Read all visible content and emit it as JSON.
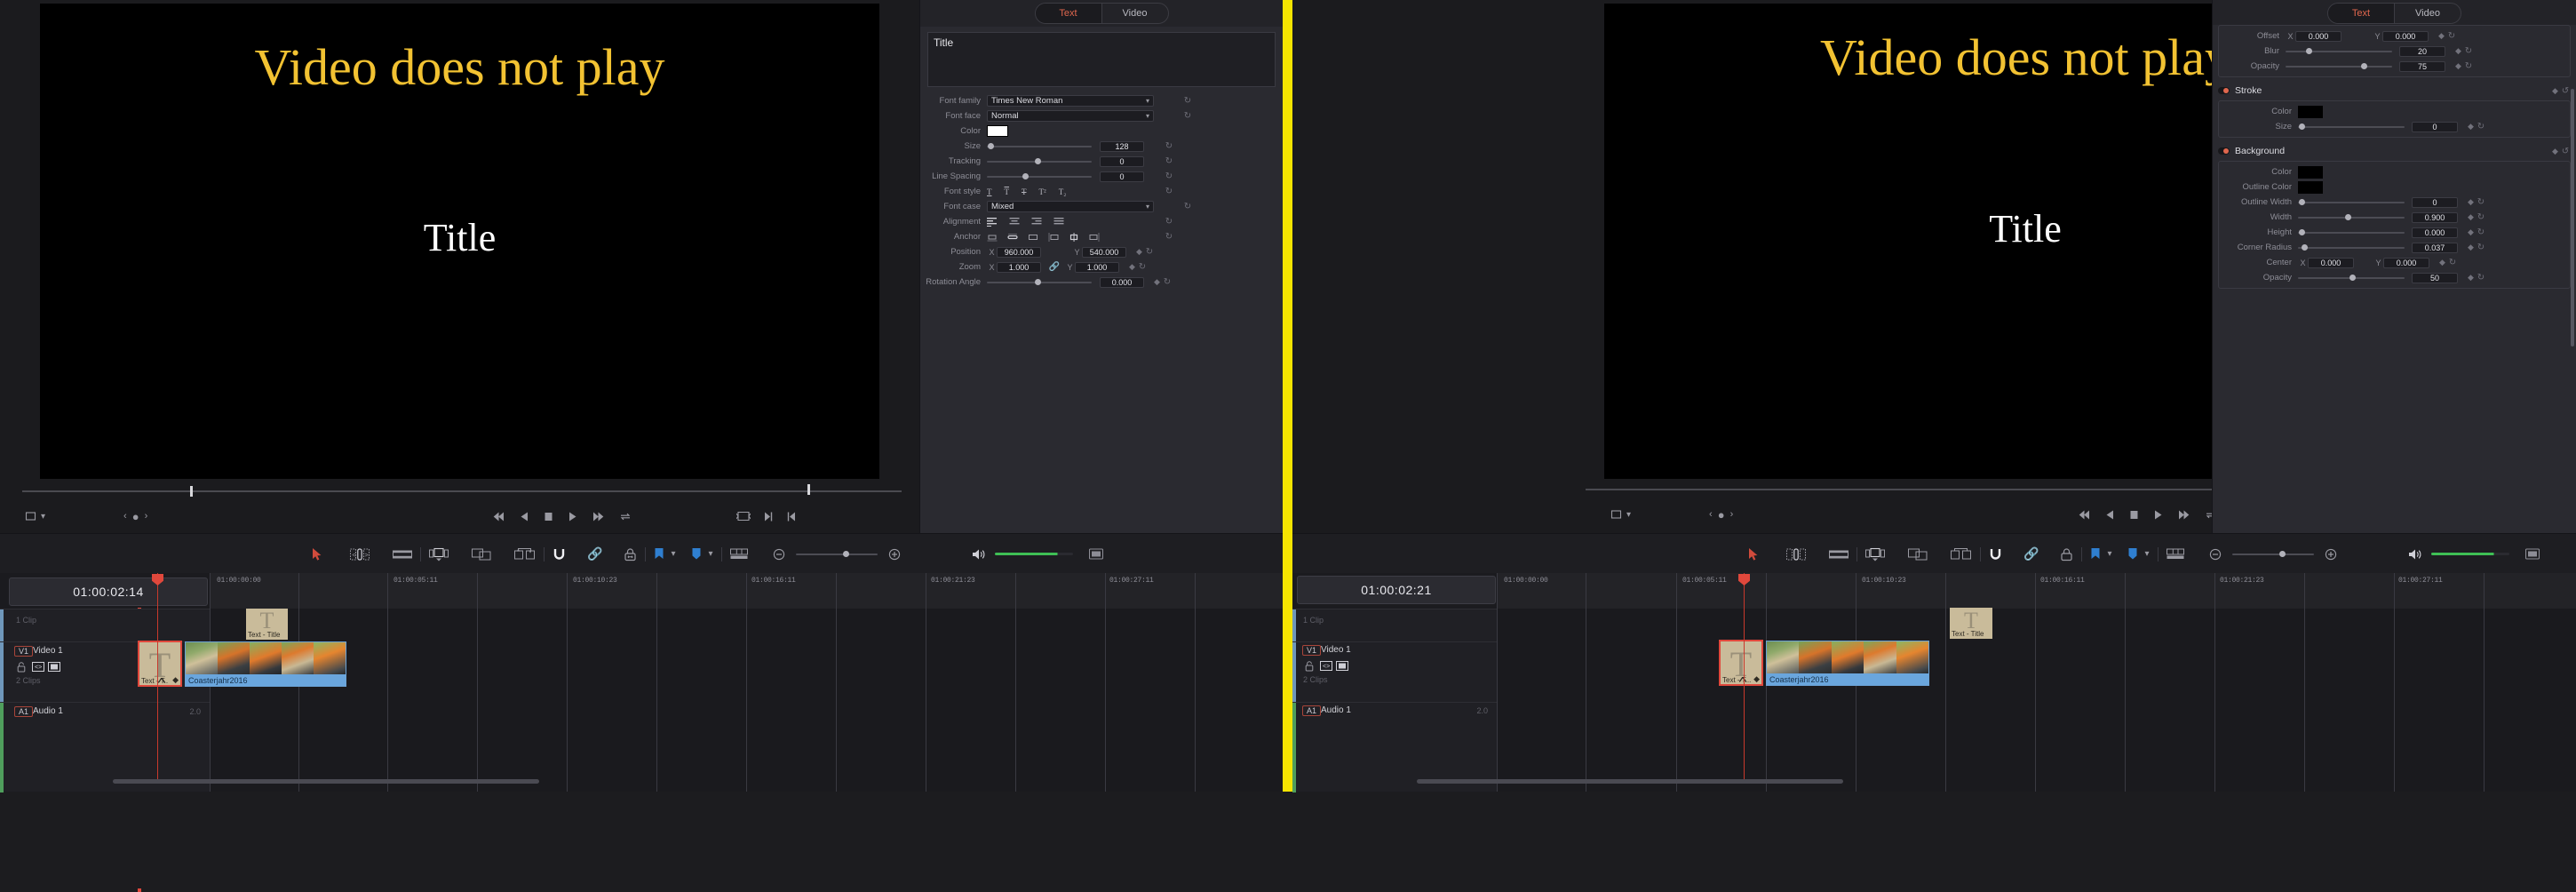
{
  "app": {
    "accent": "#e0674e",
    "divider_color": "#f5e400"
  },
  "left_viewer": {
    "title_text": "Video does not play",
    "subtitle_text": "Title",
    "title_color": "#f2c232",
    "subtitle_color": "#ffffff"
  },
  "right_viewer": {
    "title_text": "Video does not play",
    "subtitle_text": "Title",
    "title_color": "#f2c232",
    "subtitle_color": "#ffffff"
  },
  "transport": {
    "icons": [
      "first-frame-icon",
      "reverse-play-icon",
      "stop-icon",
      "play-icon",
      "last-frame-icon",
      "loop-icon"
    ],
    "left_icons": [
      "crop-icon",
      "chevron-down-icon",
      "marker-prev-icon",
      "marker-dot-icon",
      "marker-next-icon"
    ],
    "right_icons": [
      "safe-area-icon",
      "next-clip-icon",
      "prev-clip-icon"
    ]
  },
  "left_inspector": {
    "tabs": [
      {
        "label": "Text",
        "selected": true
      },
      {
        "label": "Video",
        "selected": false
      }
    ],
    "text_value": "Title",
    "rows": {
      "font_family": {
        "label": "Font family",
        "value": "Times New Roman"
      },
      "font_face": {
        "label": "Font face",
        "value": "Normal"
      },
      "color": {
        "label": "Color",
        "value": "#ffffff"
      },
      "size": {
        "label": "Size",
        "value": "128",
        "knob_pct": 3
      },
      "tracking": {
        "label": "Tracking",
        "value": "0",
        "knob_pct": 50
      },
      "line_spacing": {
        "label": "Line Spacing",
        "value": "0",
        "knob_pct": 38
      },
      "font_style": {
        "label": "Font style",
        "icons": [
          "underline-icon",
          "overline-icon",
          "strikethrough-icon",
          "superscript-icon",
          "subscript-icon"
        ]
      },
      "font_case": {
        "label": "Font case",
        "value": "Mixed"
      },
      "alignment": {
        "label": "Alignment",
        "icons": [
          "align-left-icon",
          "align-center-icon",
          "align-right-icon",
          "align-justify-icon"
        ]
      },
      "anchor": {
        "label": "Anchor",
        "icons": [
          "anchor-top-icon",
          "anchor-cap-icon",
          "anchor-middle-icon",
          "anchor-left-icon",
          "anchor-center-icon",
          "anchor-right-icon"
        ]
      },
      "position": {
        "label": "Position",
        "x_label": "X",
        "x": "960.000",
        "y_label": "Y",
        "y": "540.000"
      },
      "zoom": {
        "label": "Zoom",
        "x_label": "X",
        "x": "1.000",
        "y_label": "Y",
        "y": "1.000",
        "link_icon": "link-icon"
      },
      "rotation": {
        "label": "Rotation Angle",
        "value": "0.000",
        "knob_pct": 50
      }
    }
  },
  "right_inspector": {
    "tabs": [
      {
        "label": "Text",
        "selected": true
      },
      {
        "label": "Video",
        "selected": false
      }
    ],
    "dropshadow_rows": {
      "offset": {
        "label": "Offset",
        "x_label": "X",
        "x": "0.000",
        "y_label": "Y",
        "y": "0.000"
      },
      "blur": {
        "label": "Blur",
        "value": "20",
        "knob_pct": 20
      },
      "opacity": {
        "label": "Opacity",
        "value": "75",
        "knob_pct": 74
      }
    },
    "stroke": {
      "title": "Stroke",
      "enabled": true,
      "rows": {
        "color": {
          "label": "Color",
          "value": "#000000"
        },
        "size": {
          "label": "Size",
          "value": "0",
          "knob_pct": 1
        }
      }
    },
    "background": {
      "title": "Background",
      "enabled": true,
      "rows": {
        "color": {
          "label": "Color",
          "value": "#000000"
        },
        "outline_color": {
          "label": "Outline Color",
          "value": "#000000"
        },
        "outline_width": {
          "label": "Outline Width",
          "value": "0",
          "knob_pct": 1
        },
        "width": {
          "label": "Width",
          "value": "0.900",
          "knob_pct": 45
        },
        "height": {
          "label": "Height",
          "value": "0.000",
          "knob_pct": 1
        },
        "corner_radius": {
          "label": "Corner Radius",
          "value": "0.037",
          "knob_pct": 4
        },
        "center": {
          "label": "Center",
          "x_label": "X",
          "x": "0.000",
          "y_label": "Y",
          "y": "0.000"
        },
        "opacity": {
          "label": "Opacity",
          "value": "50",
          "knob_pct": 50
        }
      }
    }
  },
  "left_timeline": {
    "timecode": "01:00:02:14",
    "toolbar_icons": [
      "pointer-icon",
      "trim-edit-icon",
      "blade-icon",
      "insert-icon",
      "overwrite-icon",
      "replace-icon",
      "snapping-icon",
      "link-icon",
      "position-lock-icon",
      "flag-icon",
      "chevron-down-icon",
      "marker-icon",
      "chevron-down-icon",
      "track-view-icon",
      "zoom-out-icon",
      "zoom-slider",
      "zoom-in-icon",
      "audio-icon",
      "audio-meter",
      "fullscreen-icon"
    ],
    "ruler_labels": [
      "01:00:00:00",
      "01:00:05:11",
      "01:00:10:23",
      "01:00:16:11",
      "01:00:21:23",
      "01:00:27:11"
    ],
    "header_clipcount": "1 Clip",
    "track": {
      "badge": "V1",
      "name": "Video 1",
      "clipcount": "2 Clips",
      "icons": [
        "lock-icon",
        "auto-track-select-icon",
        "track-thumbnail-icon"
      ]
    },
    "audio_track": {
      "badge": "A1",
      "name": "Audio 1",
      "channels": "2.0"
    },
    "clips": [
      {
        "type": "text",
        "label": "Text - T..",
        "glyph": "T"
      },
      {
        "type": "video",
        "label": "Coasterjahr2016"
      }
    ],
    "header_thumb": {
      "label": "Text - Title",
      "glyph": "T"
    }
  },
  "right_timeline": {
    "timecode": "01:00:02:21",
    "toolbar_icons": [
      "pointer-icon",
      "trim-edit-icon",
      "blade-icon",
      "insert-icon",
      "overwrite-icon",
      "replace-icon",
      "snapping-icon",
      "link-icon",
      "position-lock-icon",
      "flag-icon",
      "chevron-down-icon",
      "marker-icon",
      "chevron-down-icon",
      "track-view-icon",
      "zoom-out-icon",
      "zoom-slider",
      "zoom-in-icon",
      "audio-icon",
      "audio-meter",
      "fullscreen-icon"
    ],
    "ruler_labels": [
      "01:00:00:00",
      "01:00:05:11",
      "01:00:10:23",
      "01:00:16:11",
      "01:00:21:23",
      "01:00:27:11"
    ],
    "header_clipcount": "1 Clip",
    "track": {
      "badge": "V1",
      "name": "Video 1",
      "clipcount": "2 Clips",
      "icons": [
        "lock-icon",
        "auto-track-select-icon",
        "track-thumbnail-icon"
      ]
    },
    "audio_track": {
      "badge": "A1",
      "name": "Audio 1",
      "channels": "2.0"
    },
    "clips": [
      {
        "type": "text",
        "label": "Text - T...",
        "glyph": "T"
      },
      {
        "type": "video",
        "label": "Coasterjahr2016"
      }
    ],
    "header_thumb": {
      "label": "Text - Title",
      "glyph": "T"
    }
  }
}
